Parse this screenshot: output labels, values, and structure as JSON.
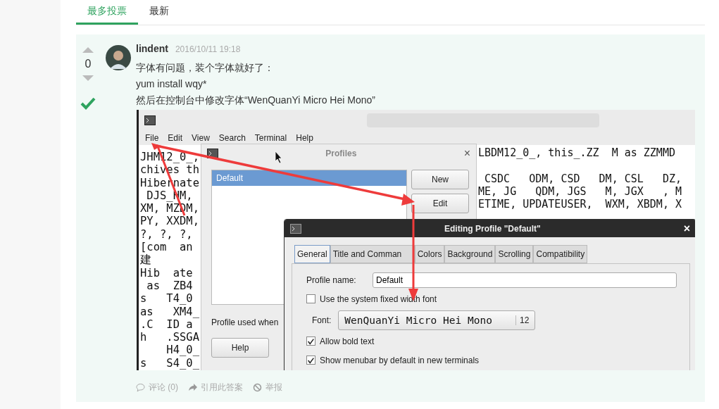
{
  "tabs": [
    {
      "label": "最多投票",
      "selected": true
    },
    {
      "label": "最新",
      "selected": false
    }
  ],
  "answer": {
    "votes": "0",
    "accepted": true,
    "author": "lindent",
    "time": "2016/10/11 19:18",
    "lines": [
      "字体有问题，装个字体就好了：",
      "yum install wqy*",
      "然后在控制台中修改字体“WenQuanYi Micro Hei Mono”"
    ],
    "screenshot": {
      "menu": [
        "File",
        "Edit",
        "View",
        "Search",
        "Terminal",
        "Help"
      ],
      "terminal_left": [
        "JHM12_0_,",
        "chives th",
        "Hibernate",
        " DJS_HM,",
        "XM, MZDM,",
        "PY, XXDM,",
        "?, ?, ?,",
        "[com  an",
        "建",
        "Hib  ate",
        " as  ZB4",
        "s   T4_0",
        "as   XM4_",
        ".C  ID a",
        "h   .SSGA",
        "    H4_0_",
        "s   S4_0_"
      ],
      "terminal_right": [
        "LBDM12_0_, this_.ZZ  M as ZZMMD",
        " CSDC   ODM, CSD   DM, CSL   DZ,",
        "ME, JG   QDM, JGS   M, JGX   , M",
        "ETIME, UPDATEUSER,  WXM, XBDM, X"
      ],
      "profiles_dialog": {
        "title": "Profiles",
        "close": "×",
        "profiles": [
          {
            "label": "Default",
            "selected": true
          }
        ],
        "buttons": [
          "New",
          "Edit"
        ],
        "note": "Profile used when",
        "help": "Help"
      },
      "edit_dialog": {
        "title": "Editing Profile \"Default\"",
        "close": "×",
        "tabs": [
          {
            "label": "General",
            "selected": true
          },
          {
            "label": "Title and Comman",
            "selected": false
          },
          {
            "label": "Colors",
            "selected": false
          },
          {
            "label": "Background",
            "selected": false
          },
          {
            "label": "Scrolling",
            "selected": false
          },
          {
            "label": "Compatibility",
            "selected": false
          }
        ],
        "profile_name_label": "Profile name:",
        "profile_name": "Default",
        "rows": [
          {
            "kind": "checkbox",
            "label": "Use the system fixed width font",
            "checked": false
          },
          {
            "kind": "font",
            "label": "Font:",
            "font": "WenQuanYi Micro Hei Mono",
            "size": "12"
          },
          {
            "kind": "checkbox",
            "label": "Allow bold text",
            "checked": true
          },
          {
            "kind": "checkbox",
            "label": "Show menubar by default in new terminals",
            "checked": true
          }
        ]
      }
    },
    "actions": [
      {
        "kind": "comment",
        "label": "评论 (0)"
      },
      {
        "kind": "quote",
        "label": "引用此答案"
      },
      {
        "kind": "report",
        "label": "举报"
      }
    ]
  }
}
